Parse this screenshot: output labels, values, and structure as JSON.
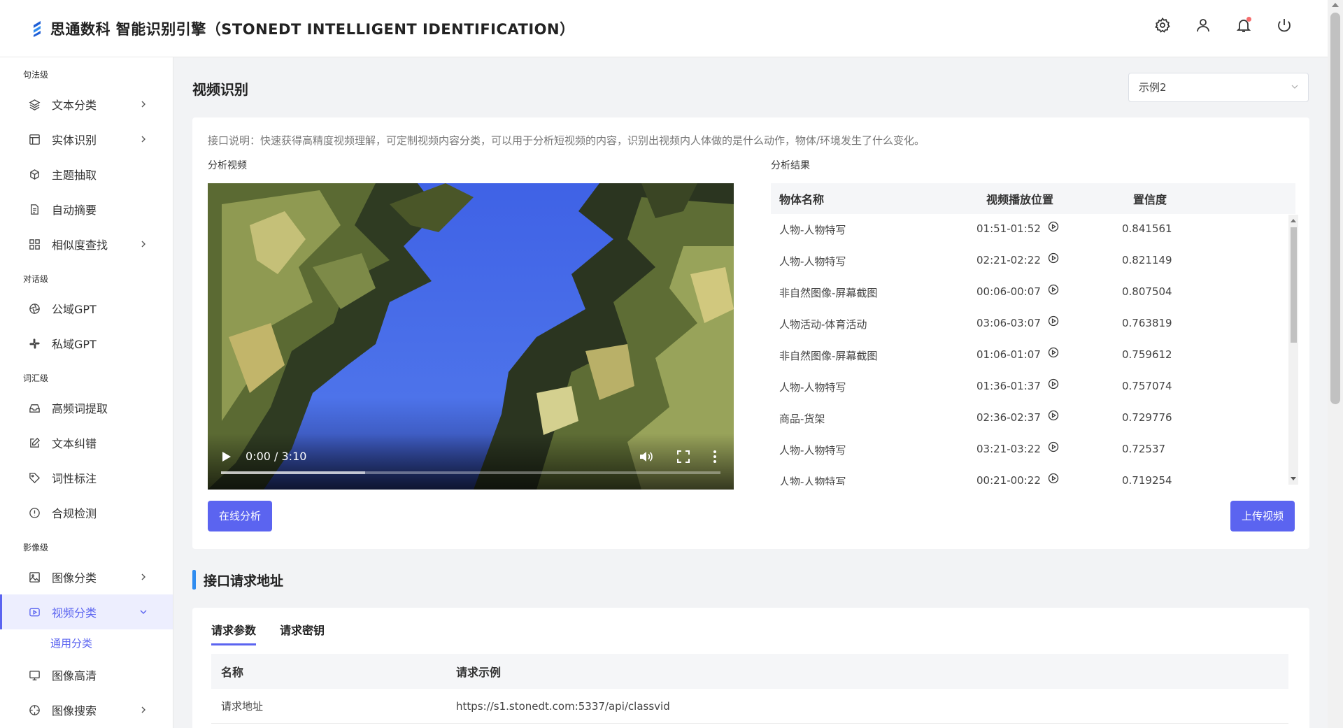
{
  "header": {
    "brand": "思通数科 智能识别引擎（STONEDT INTELLIGENT IDENTIFICATION）"
  },
  "sidebar": {
    "groups": [
      {
        "title": "句法级",
        "items": [
          {
            "label": "文本分类"
          },
          {
            "label": "实体识别"
          },
          {
            "label": "主题抽取"
          },
          {
            "label": "自动摘要"
          },
          {
            "label": "相似度查找"
          }
        ]
      },
      {
        "title": "对话级",
        "items": [
          {
            "label": "公域GPT"
          },
          {
            "label": "私域GPT"
          }
        ]
      },
      {
        "title": "词汇级",
        "items": [
          {
            "label": "高频词提取"
          },
          {
            "label": "文本纠错"
          },
          {
            "label": "词性标注"
          },
          {
            "label": "合规检测"
          }
        ]
      },
      {
        "title": "影像级",
        "items": [
          {
            "label": "图像分类"
          },
          {
            "label": "视频分类"
          },
          {
            "label": "图像高清"
          },
          {
            "label": "图像搜索"
          }
        ]
      }
    ],
    "sub_item": "通用分类"
  },
  "main": {
    "title": "视频识别",
    "select_value": "示例2",
    "description": "接口说明：快速获得高精度视频理解，可定制视频内容分类，可以用于分析短视频的内容，识别出视频内人体做的是什么动作，物体/环境发生了什么变化。",
    "label_video": "分析视频",
    "label_result": "分析结果",
    "video": {
      "time": "0:00 / 3:10"
    },
    "result_headers": [
      "物体名称",
      "视频播放位置",
      "置信度"
    ],
    "results": [
      {
        "name": "人物-人物特写",
        "pos": "01:51-01:52",
        "conf": "0.841561"
      },
      {
        "name": "人物-人物特写",
        "pos": "02:21-02:22",
        "conf": "0.821149"
      },
      {
        "name": "非自然图像-屏幕截图",
        "pos": "00:06-00:07",
        "conf": "0.807504"
      },
      {
        "name": "人物活动-体育活动",
        "pos": "03:06-03:07",
        "conf": "0.763819"
      },
      {
        "name": "非自然图像-屏幕截图",
        "pos": "01:06-01:07",
        "conf": "0.759612"
      },
      {
        "name": "人物-人物特写",
        "pos": "01:36-01:37",
        "conf": "0.757074"
      },
      {
        "name": "商品-货架",
        "pos": "02:36-02:37",
        "conf": "0.729776"
      },
      {
        "name": "人物-人物特写",
        "pos": "03:21-03:22",
        "conf": "0.72537"
      },
      {
        "name": "人物-人物特写",
        "pos": "00:21-00:22",
        "conf": "0.719254"
      }
    ],
    "btn_analyze": "在线分析",
    "btn_upload": "上传视频",
    "section_title": "接口请求地址",
    "tabs": [
      "请求参数",
      "请求密钥"
    ],
    "param_headers": [
      "名称",
      "请求示例"
    ],
    "params": [
      {
        "name": "请求地址",
        "value": "https://s1.stonedt.com:5337/api/classvid"
      }
    ]
  },
  "colors": {
    "accent": "#5b64f0",
    "section_bar": "#2f8cf0"
  }
}
